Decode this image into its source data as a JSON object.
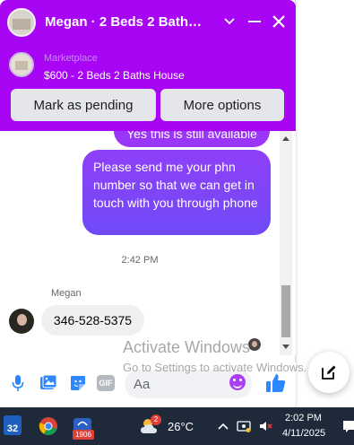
{
  "header": {
    "title": "Megan · 2 Beds 2 Baths H...",
    "product_sub": "Marketplace",
    "product_title": "$600 - 2 Beds 2 Baths House",
    "mark_pending_label": "Mark as pending",
    "more_options_label": "More options"
  },
  "messages": {
    "partial_outgoing": "Yes this is still available",
    "outgoing_text": "Please send me your phn number so that we can get in touch with you through phone",
    "timestamp": "2:42 PM",
    "sender_name": "Megan",
    "incoming_text": "346-528-5375"
  },
  "watermark": {
    "title": "Activate Windows",
    "subtitle": "Go to Settings to activate Windows."
  },
  "composer": {
    "placeholder": "Aa",
    "gif_label": "GIF"
  },
  "taskbar": {
    "badge_number": "32",
    "app_badge": "1906",
    "weather_temp": "26°C",
    "weather_alert": "2",
    "time": "2:02 PM",
    "date": "4/11/2025"
  },
  "colors": {
    "header_bg": "#a805f5",
    "bubble_outgoing": "#7f42f7",
    "accent": "#2d88ff",
    "taskbar_bg": "#1e2a3a"
  },
  "icons": [
    "chevron-down-icon",
    "minimize-icon",
    "close-icon",
    "microphone-icon",
    "image-icon",
    "sticker-icon",
    "gif-icon",
    "emoji-icon",
    "thumbs-up-icon",
    "new-message-icon",
    "weather-icon"
  ]
}
